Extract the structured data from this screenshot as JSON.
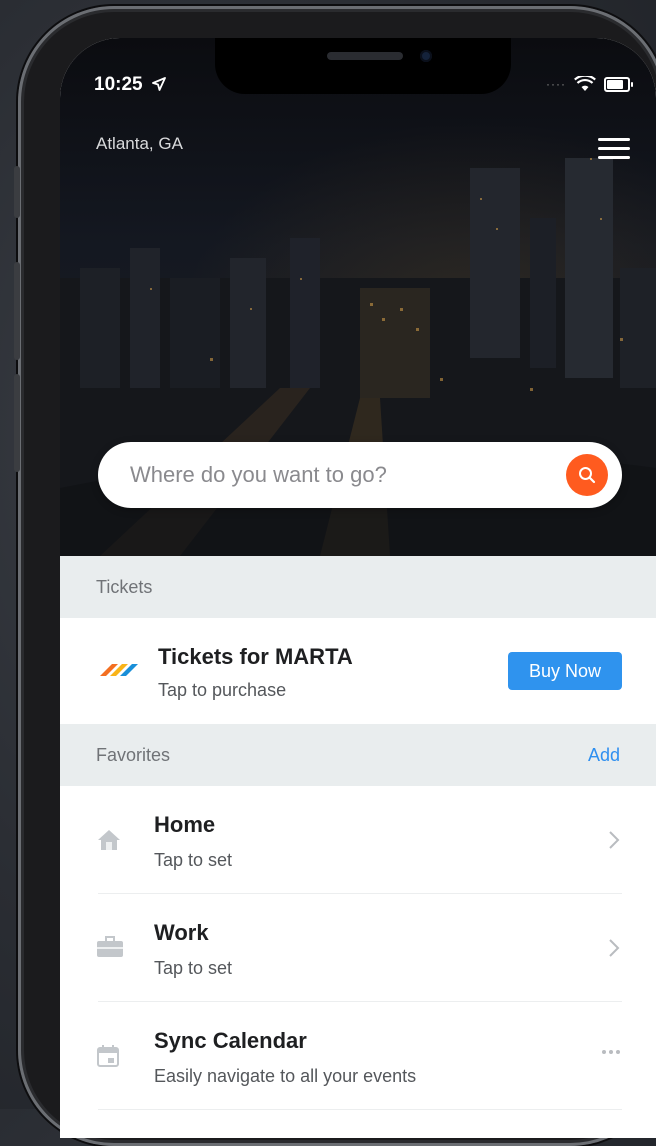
{
  "status_bar": {
    "time": "10:25"
  },
  "header": {
    "location": "Atlanta, GA"
  },
  "search": {
    "placeholder": "Where do you want to go?"
  },
  "tickets": {
    "section_title": "Tickets",
    "title": "Tickets for MARTA",
    "subtitle": "Tap to purchase",
    "buy_label": "Buy Now"
  },
  "favorites": {
    "section_title": "Favorites",
    "add_label": "Add",
    "items": [
      {
        "title": "Home",
        "subtitle": "Tap to set",
        "icon": "home-icon"
      },
      {
        "title": "Work",
        "subtitle": "Tap to set",
        "icon": "briefcase-icon"
      },
      {
        "title": "Sync Calendar",
        "subtitle": "Easily navigate to all your events",
        "icon": "calendar-icon"
      }
    ]
  },
  "colors": {
    "accent": "#2f93ee",
    "search_button": "#ff5b1f",
    "section_bg": "#e9edee"
  }
}
